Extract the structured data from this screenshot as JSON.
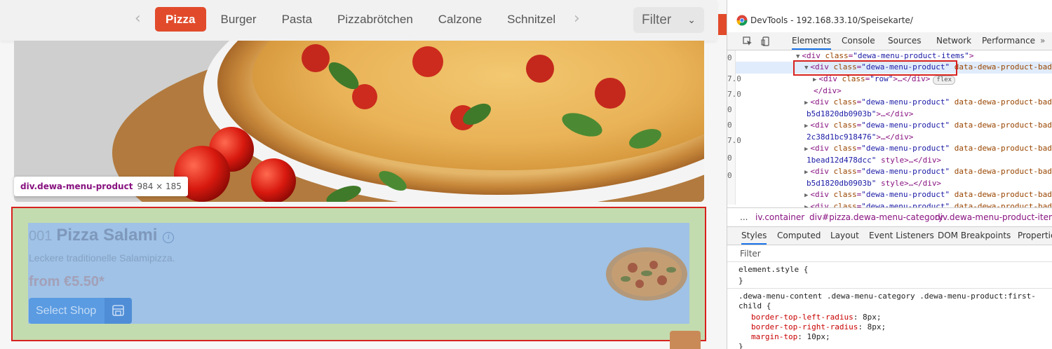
{
  "categories": {
    "items": [
      "Pizza",
      "Burger",
      "Pasta",
      "Pizzabrötchen",
      "Calzone",
      "Schnitzel"
    ],
    "filter_label": "Filter"
  },
  "tooltip": {
    "tag": "div.dewa-menu-product",
    "size": "984 × 185"
  },
  "product": {
    "number": "001",
    "name": "Pizza Salami",
    "description": "Leckere traditionelle Salamipizza.",
    "price": "from €5.50*",
    "shop_button": "Select Shop"
  },
  "devtools": {
    "title": "DevTools - 192.168.33.10/Speisekarte/",
    "tabs": [
      "Elements",
      "Console",
      "Sources",
      "Network",
      "Performance"
    ],
    "gutter": [
      "0",
      "7.0",
      "7.0",
      "0",
      "0",
      "7.0",
      "0",
      "0"
    ],
    "tree": [
      {
        "pre": "▼",
        "tag": "<div ",
        "attr": "class",
        "val": "\"dewa-menu-product-items\"",
        "post": ">",
        "rest": ""
      },
      {
        "pre": "▼",
        "tag": "<div ",
        "attr": "class",
        "val": "\"dewa-menu-product\"",
        "post": " ",
        "rest": "data-dewa-product-bad"
      },
      {
        "pre": "▶",
        "tag": "<div ",
        "attr": "class",
        "val": "\"row\"",
        "post": ">…</div>",
        "rest": "flex"
      },
      {
        "pre": "",
        "tag": "</div>",
        "attr": "",
        "val": "",
        "post": "",
        "rest": ""
      },
      {
        "pre": "▶",
        "tag": "<div ",
        "attr": "class",
        "val": "\"dewa-menu-product\"",
        "post": " ",
        "rest": "data-dewa-product-bad"
      },
      {
        "pre": "",
        "tag": "",
        "attr": "",
        "val": "b5d1820db0903b\"",
        "post": ">…</div>",
        "rest": ""
      },
      {
        "pre": "▶",
        "tag": "<div ",
        "attr": "class",
        "val": "\"dewa-menu-product\"",
        "post": " ",
        "rest": "data-dewa-product-bad"
      },
      {
        "pre": "",
        "tag": "",
        "attr": "",
        "val": "2c38d1bc918476\"",
        "post": ">…</div>",
        "rest": ""
      },
      {
        "pre": "▶",
        "tag": "<div ",
        "attr": "class",
        "val": "\"dewa-menu-product\"",
        "post": " ",
        "rest": "data-dewa-product-bad"
      },
      {
        "pre": "",
        "tag": "",
        "attr": "",
        "val": "1bead12d478dcc\"",
        "post": " style>…</div>",
        "rest": ""
      },
      {
        "pre": "▶",
        "tag": "<div ",
        "attr": "class",
        "val": "\"dewa-menu-product\"",
        "post": " ",
        "rest": "data-dewa-product-bad"
      },
      {
        "pre": "",
        "tag": "",
        "attr": "",
        "val": "b5d1820db0903b\"",
        "post": " style>…</div>",
        "rest": ""
      },
      {
        "pre": "▶",
        "tag": "<div ",
        "attr": "class",
        "val": "\"dewa-menu-product\"",
        "post": " ",
        "rest": "data-dewa-product-bad"
      },
      {
        "pre": "▶",
        "tag": "<div ",
        "attr": "class",
        "val": "\"dewa-menu-product\"",
        "post": " ",
        "rest": "data-dewa-product-bad"
      }
    ],
    "breadcrumbs": [
      "...",
      "iv.container",
      "div#pizza.dewa-menu-category",
      "div.dewa-menu-product-items"
    ],
    "subtabs": [
      "Styles",
      "Computed",
      "Layout",
      "Event Listeners",
      "DOM Breakpoints",
      "Properties"
    ],
    "filter_placeholder": "Filter",
    "styles": {
      "element_style": "element.style {",
      "close": "}",
      "selector1": ".dewa-menu-content .dewa-menu-category .dewa-menu-product:first-",
      "selector2": "child {",
      "rules": [
        {
          "prop": "border-top-left-radius",
          "val": "8px;"
        },
        {
          "prop": "border-top-right-radius",
          "val": "8px;"
        },
        {
          "prop": "margin-top",
          "val": "10px;"
        }
      ]
    }
  },
  "colors": {
    "accent": "#e14b2b",
    "highlight_margin": "#c3dcaf",
    "highlight_content": "#9fc2e6",
    "selection_border": "#d7221f"
  }
}
